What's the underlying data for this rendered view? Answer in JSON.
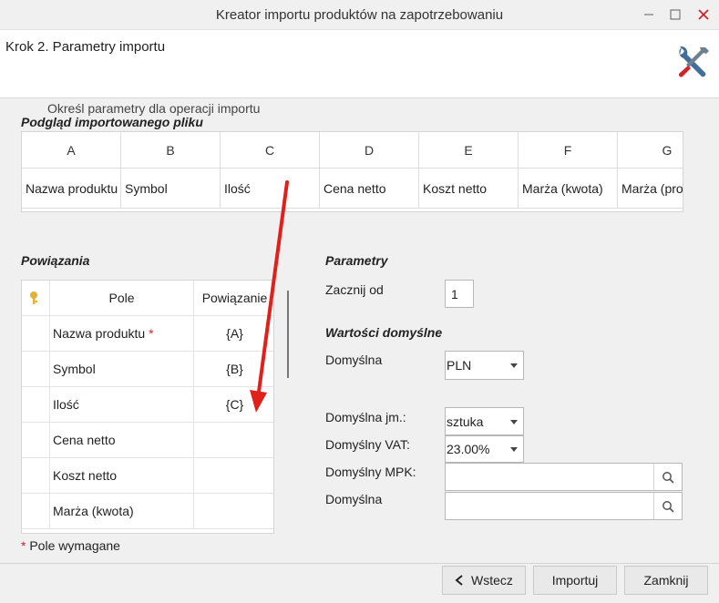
{
  "window": {
    "title": "Kreator importu produktów na zapotrzebowaniu"
  },
  "header": {
    "step": "Krok 2. Parametry importu"
  },
  "subtitle": "Określ parametry dla operacji importu",
  "preview": {
    "title": "Podgląd importowanego pliku",
    "columns": [
      "A",
      "B",
      "C",
      "D",
      "E",
      "F",
      "G"
    ],
    "row": [
      "Nazwa produktu",
      "Symbol",
      "Ilość",
      "Cena netto",
      "Koszt netto",
      "Marża (kwota)",
      "Marża (pro"
    ]
  },
  "links": {
    "title": "Powiązania",
    "headers": {
      "field": "Pole",
      "link": "Powiązanie"
    },
    "rows": [
      {
        "field": "Nazwa produktu",
        "required": "*",
        "link": "{A}"
      },
      {
        "field": "Symbol",
        "link": "{B}"
      },
      {
        "field": "Ilość",
        "link": "{C}"
      },
      {
        "field": "Cena netto",
        "link": ""
      },
      {
        "field": "Koszt netto",
        "link": ""
      },
      {
        "field": "Marża (kwota)",
        "link": ""
      }
    ]
  },
  "required_note": {
    "star": "*",
    "text": "Pole wymagane"
  },
  "params": {
    "title": "Parametry",
    "start_label": "Zacznij od",
    "start_value": "1",
    "defaults_title": "Wartości domyślne",
    "currency_label": "Domyślna",
    "currency_value": "PLN",
    "unit_label": "Domyślna jm.:",
    "unit_value": "sztuka",
    "vat_label": "Domyślny VAT:",
    "vat_value": "23.00%",
    "mpk_label": "Domyślny MPK:",
    "mpk_value": "",
    "last_label": "Domyślna",
    "last_value": ""
  },
  "buttons": {
    "back": "Wstecz",
    "import": "Importuj",
    "close": "Zamknij"
  },
  "colors": {
    "accent_red": "#d0242a",
    "tools_blue": "#3f6f9a"
  }
}
